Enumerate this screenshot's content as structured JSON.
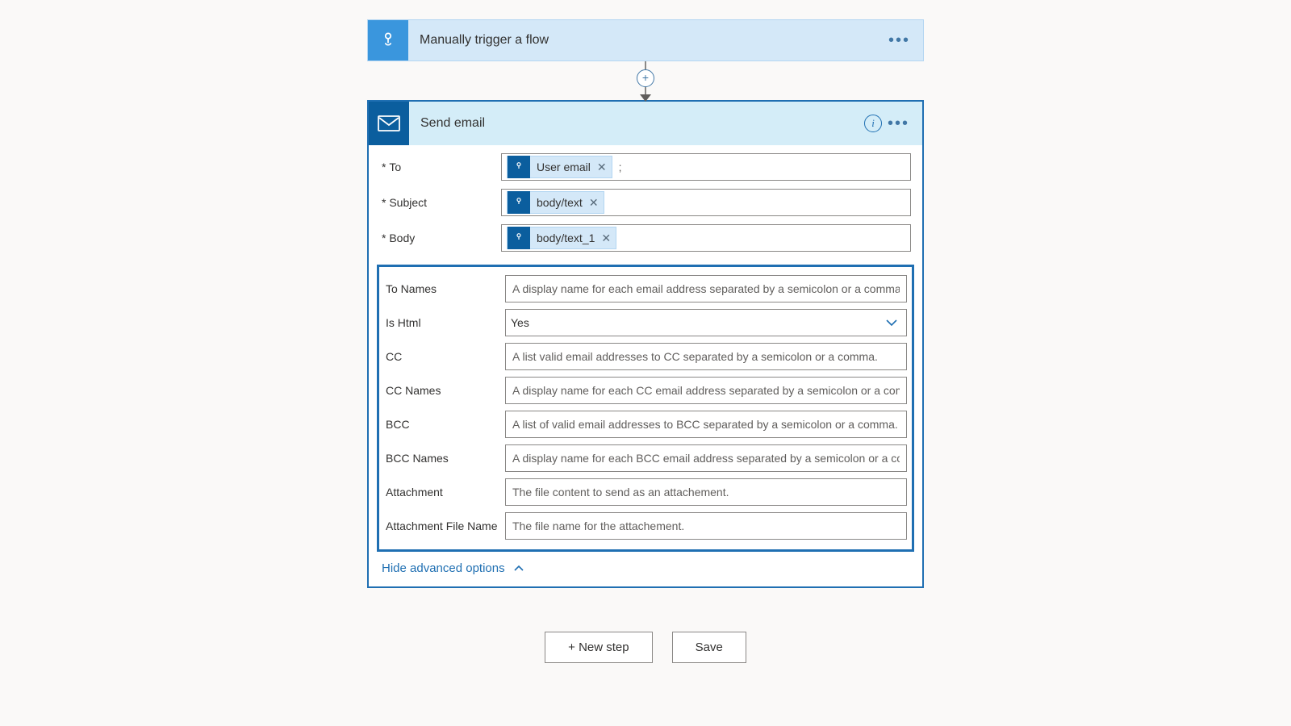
{
  "trigger": {
    "title": "Manually trigger a flow"
  },
  "action": {
    "title": "Send email",
    "fields": {
      "to": {
        "label": "To",
        "token": "User email",
        "trail": ";"
      },
      "subject": {
        "label": "Subject",
        "token": "body/text"
      },
      "body": {
        "label": "Body",
        "token": "body/text_1"
      },
      "toNames": {
        "label": "To Names",
        "ph": "A display name for each email address separated by a semicolon or a comma."
      },
      "isHtml": {
        "label": "Is Html",
        "value": "Yes"
      },
      "cc": {
        "label": "CC",
        "ph": "A list valid email addresses to CC separated by a semicolon or a comma."
      },
      "ccNames": {
        "label": "CC Names",
        "ph": "A display name for each CC email address separated by a semicolon or a comma."
      },
      "bcc": {
        "label": "BCC",
        "ph": "A list of valid email addresses to BCC separated by a semicolon or a comma."
      },
      "bccNames": {
        "label": "BCC Names",
        "ph": "A display name for each BCC email address separated by a semicolon or a comma."
      },
      "attach": {
        "label": "Attachment",
        "ph": "The file content to send as an attachement."
      },
      "attachFileName": {
        "label": "Attachment File Name",
        "ph": "The file name for the attachement."
      }
    },
    "hideAdvanced": "Hide advanced options"
  },
  "footer": {
    "newStep": "+ New step",
    "save": "Save"
  }
}
